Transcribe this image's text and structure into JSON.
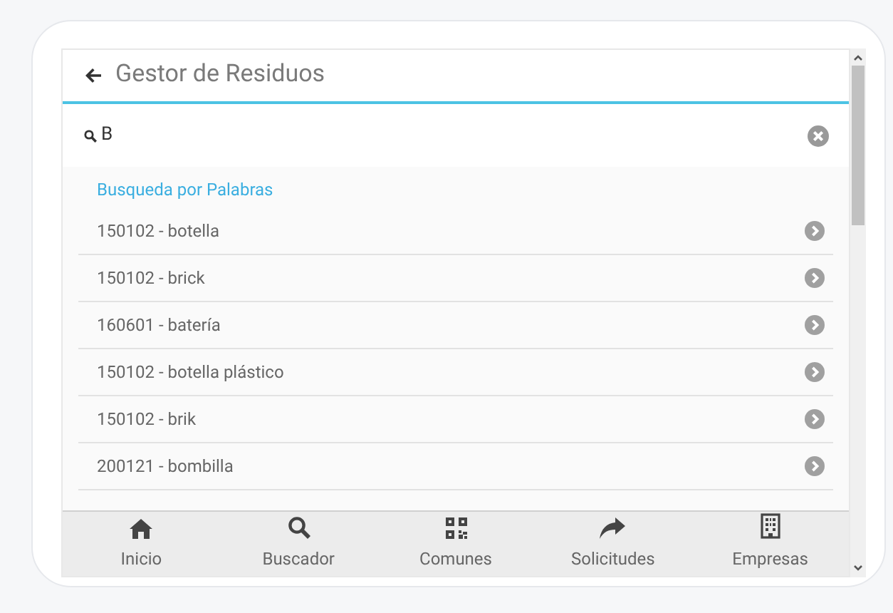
{
  "header": {
    "title": "Gestor de Residuos"
  },
  "search": {
    "value": "B"
  },
  "section_label": "Busqueda por Palabras",
  "results": [
    {
      "label": "150102 - botella"
    },
    {
      "label": "150102 - brick"
    },
    {
      "label": "160601 - batería"
    },
    {
      "label": "150102 - botella plástico"
    },
    {
      "label": "150102 - brik"
    },
    {
      "label": "200121 - bombilla"
    }
  ],
  "nav": [
    {
      "kind": "home",
      "label": "Inicio"
    },
    {
      "kind": "search",
      "label": "Buscador"
    },
    {
      "kind": "qr",
      "label": "Comunes"
    },
    {
      "kind": "share",
      "label": "Solicitudes"
    },
    {
      "kind": "building",
      "label": "Empresas"
    }
  ]
}
